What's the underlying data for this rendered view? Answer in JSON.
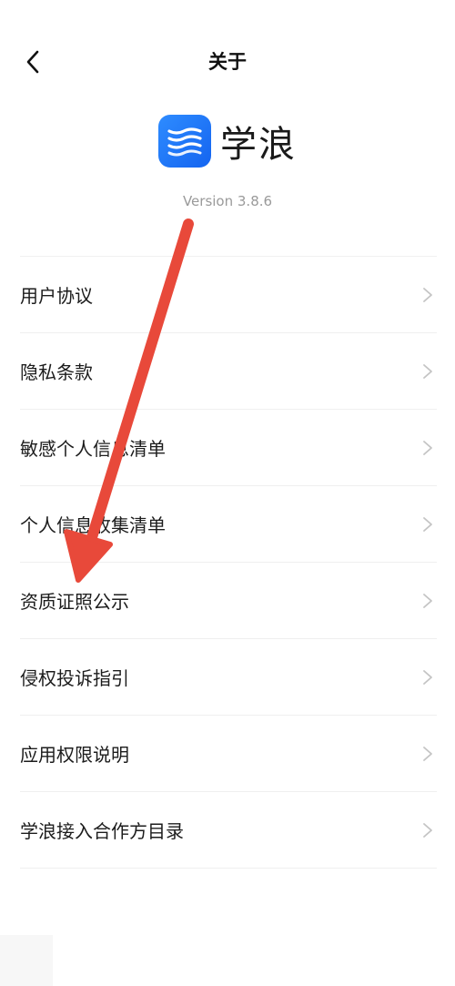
{
  "nav": {
    "title": "关于"
  },
  "brand": {
    "name": "学浪",
    "version": "Version 3.8.6",
    "icon": "xuelang-logo-icon",
    "color": "#1a6ff5"
  },
  "menu": {
    "items": [
      {
        "label": "用户协议"
      },
      {
        "label": "隐私条款"
      },
      {
        "label": "敏感个人信息清单"
      },
      {
        "label": "个人信息收集清单"
      },
      {
        "label": "资质证照公示"
      },
      {
        "label": "侵权投诉指引"
      },
      {
        "label": "应用权限说明"
      },
      {
        "label": "学浪接入合作方目录"
      }
    ]
  },
  "annotation": {
    "arrow_color": "#e8493a",
    "points_to": "资质证照公示"
  }
}
